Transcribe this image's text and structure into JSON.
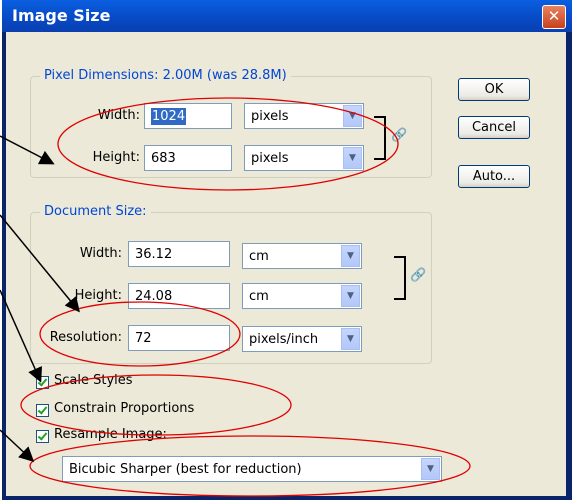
{
  "window": {
    "title": "Image Size",
    "close_glyph": "✕"
  },
  "pixel_dimensions": {
    "legend": "Pixel Dimensions:  2.00M (was 28.8M)",
    "width_label": "Width:",
    "width_value": "1024",
    "width_unit": "pixels",
    "height_label": "Height:",
    "height_value": "683",
    "height_unit": "pixels"
  },
  "document_size": {
    "legend": "Document Size:",
    "width_label": "Width:",
    "width_value": "36.12",
    "width_unit": "cm",
    "height_label": "Height:",
    "height_value": "24.08",
    "height_unit": "cm",
    "resolution_label": "Resolution:",
    "resolution_value": "72",
    "resolution_unit": "pixels/inch"
  },
  "buttons": {
    "ok": "OK",
    "cancel": "Cancel",
    "auto": "Auto..."
  },
  "options": {
    "scale_styles": "Scale Styles",
    "constrain_proportions": "Constrain Proportions",
    "resample_image": "Resample Image:",
    "resample_method": "Bicubic Sharper (best for reduction)"
  },
  "annotations": {
    "ellipse_color": "#e00000",
    "arrow_color": "#000000"
  }
}
